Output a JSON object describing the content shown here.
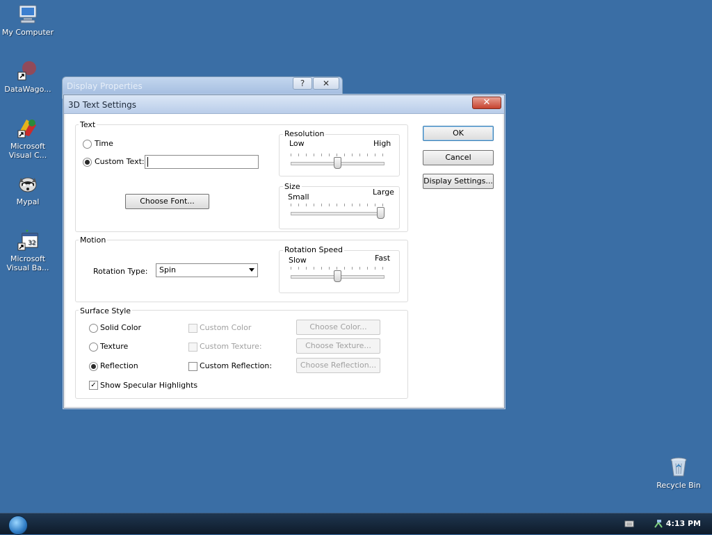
{
  "desktop": {
    "icons": [
      {
        "label": "My Computer",
        "icon": "computer-icon"
      },
      {
        "label": "DataWago...",
        "icon": "datawagon-shortcut-icon"
      },
      {
        "label": "Microsoft Visual C...",
        "label_lines": [
          "Microsoft",
          "Visual C..."
        ],
        "icon": "visual-c-shortcut-icon"
      },
      {
        "label": "Mypal",
        "icon": "mypal-browser-icon"
      },
      {
        "label": "Microsoft Visual Ba...",
        "label_lines": [
          "Microsoft",
          "Visual Ba..."
        ],
        "icon": "visual-basic-shortcut-icon"
      },
      {
        "label": "Recycle Bin",
        "icon": "recycle-bin-icon"
      }
    ]
  },
  "back_window": {
    "title": "Display Properties",
    "help_label": "?",
    "close_label": "✕"
  },
  "dialog": {
    "title": "3D Text Settings",
    "close_label": "✕",
    "text_group": {
      "label": "Text",
      "time_label": "Time",
      "custom_text_label": "Custom Text:",
      "custom_text_value": "",
      "choose_font_label": "Choose Font...",
      "selected": "Custom Text"
    },
    "resolution": {
      "label": "Resolution",
      "low": "Low",
      "high": "High",
      "value_fraction": 0.5
    },
    "size": {
      "label": "Size",
      "small": "Small",
      "large": "Large",
      "value_fraction": 1.0
    },
    "motion_group": {
      "label": "Motion",
      "rotation_type_label": "Rotation Type:",
      "rotation_type_value": "Spin"
    },
    "rotation_speed": {
      "label": "Rotation Speed",
      "slow": "Slow",
      "fast": "Fast",
      "value_fraction": 0.5
    },
    "surface_group": {
      "label": "Surface Style",
      "solid_color": "Solid Color",
      "texture": "Texture",
      "reflection": "Reflection",
      "selected": "Reflection",
      "custom_color": "Custom Color",
      "custom_texture": "Custom Texture:",
      "custom_reflection": "Custom Reflection:",
      "choose_color": "Choose Color...",
      "choose_texture": "Choose Texture...",
      "choose_reflection": "Choose Reflection...",
      "specular_label": "Show Specular Highlights",
      "specular_checked": true
    },
    "buttons": {
      "ok": "OK",
      "cancel": "Cancel",
      "display_settings": "Display Settings..."
    }
  },
  "taskbar": {
    "clock": "4:13 PM",
    "tray_icons": [
      "keyboard-icon",
      "network-icon"
    ]
  },
  "colors": {
    "desktop": "#3a6ea5",
    "taskbar": "#14263a"
  }
}
